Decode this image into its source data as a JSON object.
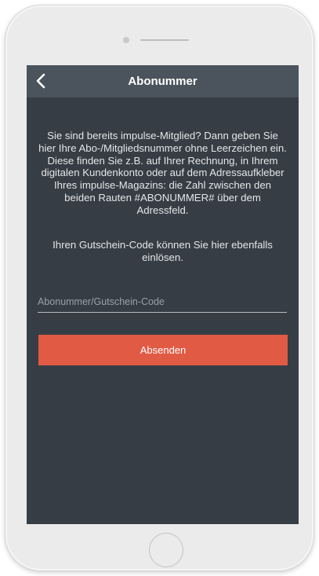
{
  "header": {
    "title": "Abonummer",
    "back_icon": "chevron-left-icon"
  },
  "main": {
    "intro_text": "Sie sind bereits impulse-Mitglied? Dann geben Sie hier Ihre Abo-/Mitgliedsnummer ohne Leerzeichen ein. Diese finden Sie z.B. auf Ihrer Rechnung, in Ihrem digitalen Kundenkonto oder auf dem Adressaufkleber Ihres impulse-Magazins: die Zahl zwischen den beiden Rauten #ABONUMMER# über dem Adressfeld.",
    "coupon_text": "Ihren Gutschein-Code können Sie hier ebenfalls einlösen.",
    "input": {
      "value": "",
      "placeholder": "Abonummer/Gutschein-Code"
    },
    "submit_label": "Absenden"
  },
  "colors": {
    "screen_background": "#363d45",
    "navbar_background": "#4b545c",
    "accent": "#e05a44",
    "text": "#e4e6e8",
    "placeholder": "#9aa0a6"
  }
}
